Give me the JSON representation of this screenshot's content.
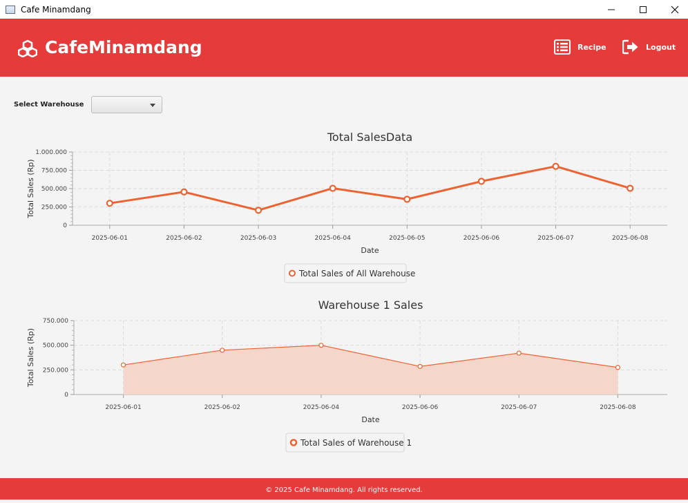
{
  "window": {
    "title": "Cafe Minamdang",
    "minimize_icon": "minimize-icon",
    "maximize_icon": "maximize-icon",
    "close_icon": "close-icon"
  },
  "header": {
    "brand": "CafeMinamdang",
    "brand_icon": "cubes-icon",
    "nav": [
      {
        "label": "Recipe",
        "icon": "list-icon"
      },
      {
        "label": "Logout",
        "icon": "logout-icon"
      }
    ],
    "background": "#e53b3b"
  },
  "filter": {
    "label": "Select Warehouse",
    "selected": ""
  },
  "footer": {
    "text": "© 2025 Cafe Minamdang. All rights reserved."
  },
  "chart_data": [
    {
      "type": "line",
      "title": "Total SalesData",
      "xlabel": "Date",
      "ylabel": "Total Sales (Rp)",
      "categories": [
        "2025-06-01",
        "2025-06-02",
        "2025-06-03",
        "2025-06-04",
        "2025-06-05",
        "2025-06-06",
        "2025-06-07",
        "2025-06-08"
      ],
      "series": [
        {
          "name": "Total Sales of All Warehouse",
          "values": [
            300000,
            455000,
            205000,
            505000,
            355000,
            600000,
            805000,
            505000
          ]
        }
      ],
      "ylim": [
        0,
        1000000
      ],
      "yticks": [
        "0",
        "250.000",
        "500.000",
        "750.000",
        "1.000.000"
      ],
      "grid": true,
      "legend": "bottom-center",
      "color": "#ee6231"
    },
    {
      "type": "area",
      "title": "Warehouse 1 Sales",
      "xlabel": "Date",
      "ylabel": "Total Sales (Rp)",
      "categories": [
        "2025-06-01",
        "2025-06-02",
        "2025-06-04",
        "2025-06-06",
        "2025-06-07",
        "2025-06-08"
      ],
      "series": [
        {
          "name": "Total Sales of Warehouse 1",
          "values": [
            300000,
            450000,
            500000,
            285000,
            420000,
            275000
          ]
        }
      ],
      "ylim": [
        0,
        750000
      ],
      "yticks": [
        "0",
        "250.000",
        "500.000",
        "750.000"
      ],
      "grid": true,
      "legend": "bottom-center",
      "color": "#ee6231",
      "fill": "#f5d6cb"
    }
  ]
}
